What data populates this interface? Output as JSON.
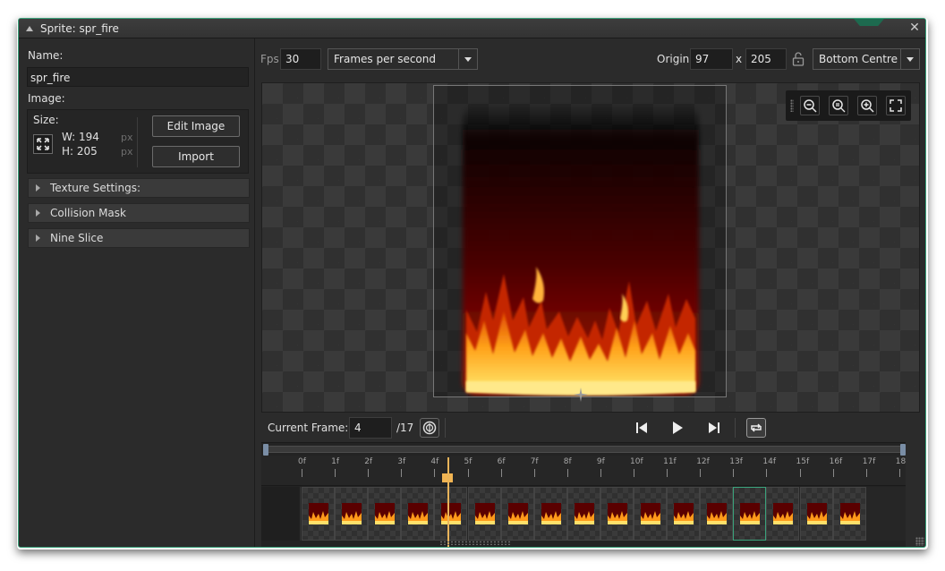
{
  "window": {
    "title": "Sprite: spr_fire"
  },
  "properties": {
    "name_label": "Name:",
    "name_value": "spr_fire",
    "image_label": "Image:",
    "size_label": "Size:",
    "width": "W: 194",
    "height": "H: 205",
    "unit": "px",
    "edit_image_label": "Edit Image",
    "import_label": "Import",
    "sections": [
      "Texture Settings:",
      "Collision Mask",
      "Nine Slice"
    ]
  },
  "toolbar": {
    "fps_label": "Fps",
    "fps_value": "30",
    "speed_mode": "Frames per second",
    "origin_label": "Origin",
    "origin_x": "97",
    "origin_sep": "x",
    "origin_y": "205",
    "origin_preset": "Bottom Centre"
  },
  "frames": {
    "current_label": "Current Frame:",
    "current_value": "4",
    "total": "/17",
    "ruler_labels": [
      "0f",
      "1f",
      "2f",
      "3f",
      "4f",
      "5f",
      "6f",
      "7f",
      "8f",
      "9f",
      "10f",
      "11f",
      "12f",
      "13f",
      "14f",
      "15f",
      "16f",
      "17f",
      "18f"
    ],
    "thumbnail_count": 17,
    "selected_frame_index": 13
  },
  "colors": {
    "accent": "#3aa27b",
    "playhead": "#e9b45a",
    "fire_bright": "#ffe36e",
    "fire_dark": "#7a0000"
  },
  "icons": [
    "resize-icon",
    "zoom-out-icon",
    "zoom-reset-icon",
    "zoom-in-icon",
    "fullscreen-icon",
    "lock-icon",
    "onion-skin-icon",
    "skip-start-icon",
    "play-icon",
    "skip-end-icon",
    "loop-icon",
    "close-icon"
  ]
}
